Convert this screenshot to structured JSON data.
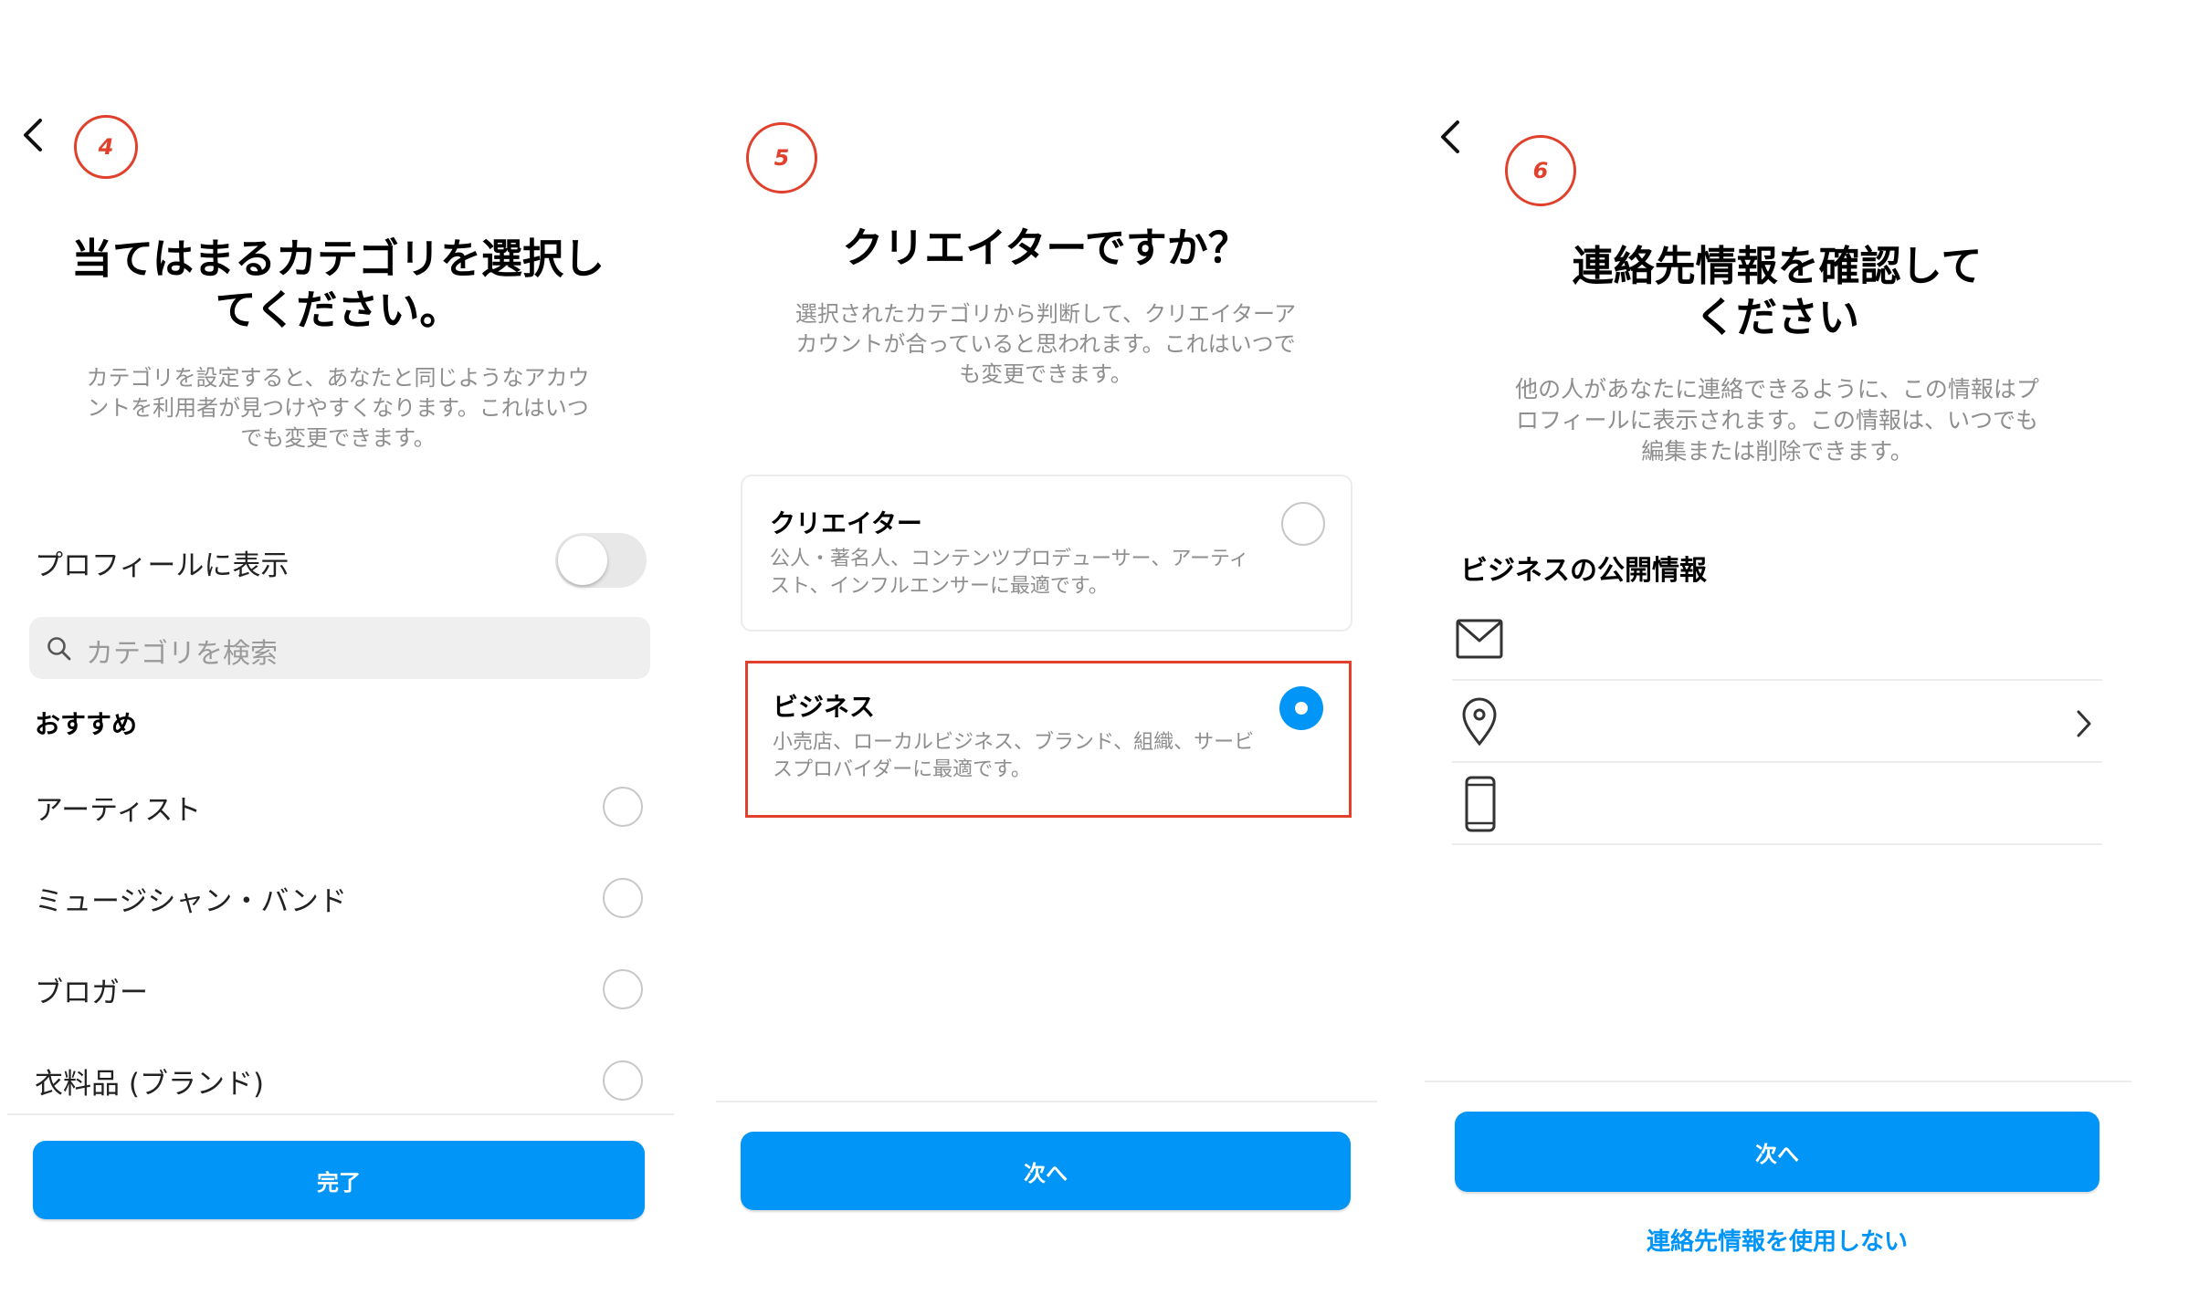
{
  "panel1": {
    "step": "4",
    "title_line1": "当てはまるカテゴリを選択し",
    "title_line2": "てください。",
    "desc_line1": "カテゴリを設定すると、あなたと同じようなアカウ",
    "desc_line2": "ントを利用者が見つけやすくなります。これはいつ",
    "desc_line3": "でも変更できます。",
    "toggle_label": "プロフィールに表示",
    "toggle_on": false,
    "search_placeholder": "カテゴリを検索",
    "section_label": "おすすめ",
    "categories": [
      {
        "label": "アーティスト"
      },
      {
        "label": "ミュージシャン・バンド"
      },
      {
        "label": "ブロガー"
      },
      {
        "label": "衣料品 (ブランド)"
      }
    ],
    "done_button": "完了"
  },
  "panel2": {
    "step": "5",
    "title": "クリエイターですか？",
    "desc_line1": "選択されたカテゴリから判断して、クリエイターア",
    "desc_line2": "カウントが合っていると思われます。これはいつで",
    "desc_line3": "も変更できます。",
    "options": [
      {
        "title": "クリエイター",
        "desc_line1": "公人・著名人、コンテンツプロデューサー、アーティ",
        "desc_line2": "スト、インフルエンサーに最適です。",
        "selected": false
      },
      {
        "title": "ビジネス",
        "desc_line1": "小売店、ローカルビジネス、ブランド、組織、サービ",
        "desc_line2": "スプロバイダーに最適です。",
        "selected": true
      }
    ],
    "next_button": "次へ"
  },
  "panel3": {
    "step": "6",
    "title_line1": "連絡先情報を確認して",
    "title_line2": "ください",
    "desc_line1": "他の人があなたに連絡できるように、この情報はプ",
    "desc_line2": "ロフィールに表示されます。この情報は、いつでも",
    "desc_line3": "編集または削除できます。",
    "section_label": "ビジネスの公開情報",
    "rows": [
      {
        "icon": "mail-icon"
      },
      {
        "icon": "location-pin-icon"
      },
      {
        "icon": "phone-icon"
      }
    ],
    "next_button": "次へ",
    "skip_link": "連絡先情報を使用しない"
  },
  "colors": {
    "accent": "#0095f6",
    "highlight": "#e0402c",
    "muted_text": "#8e8e8e"
  }
}
